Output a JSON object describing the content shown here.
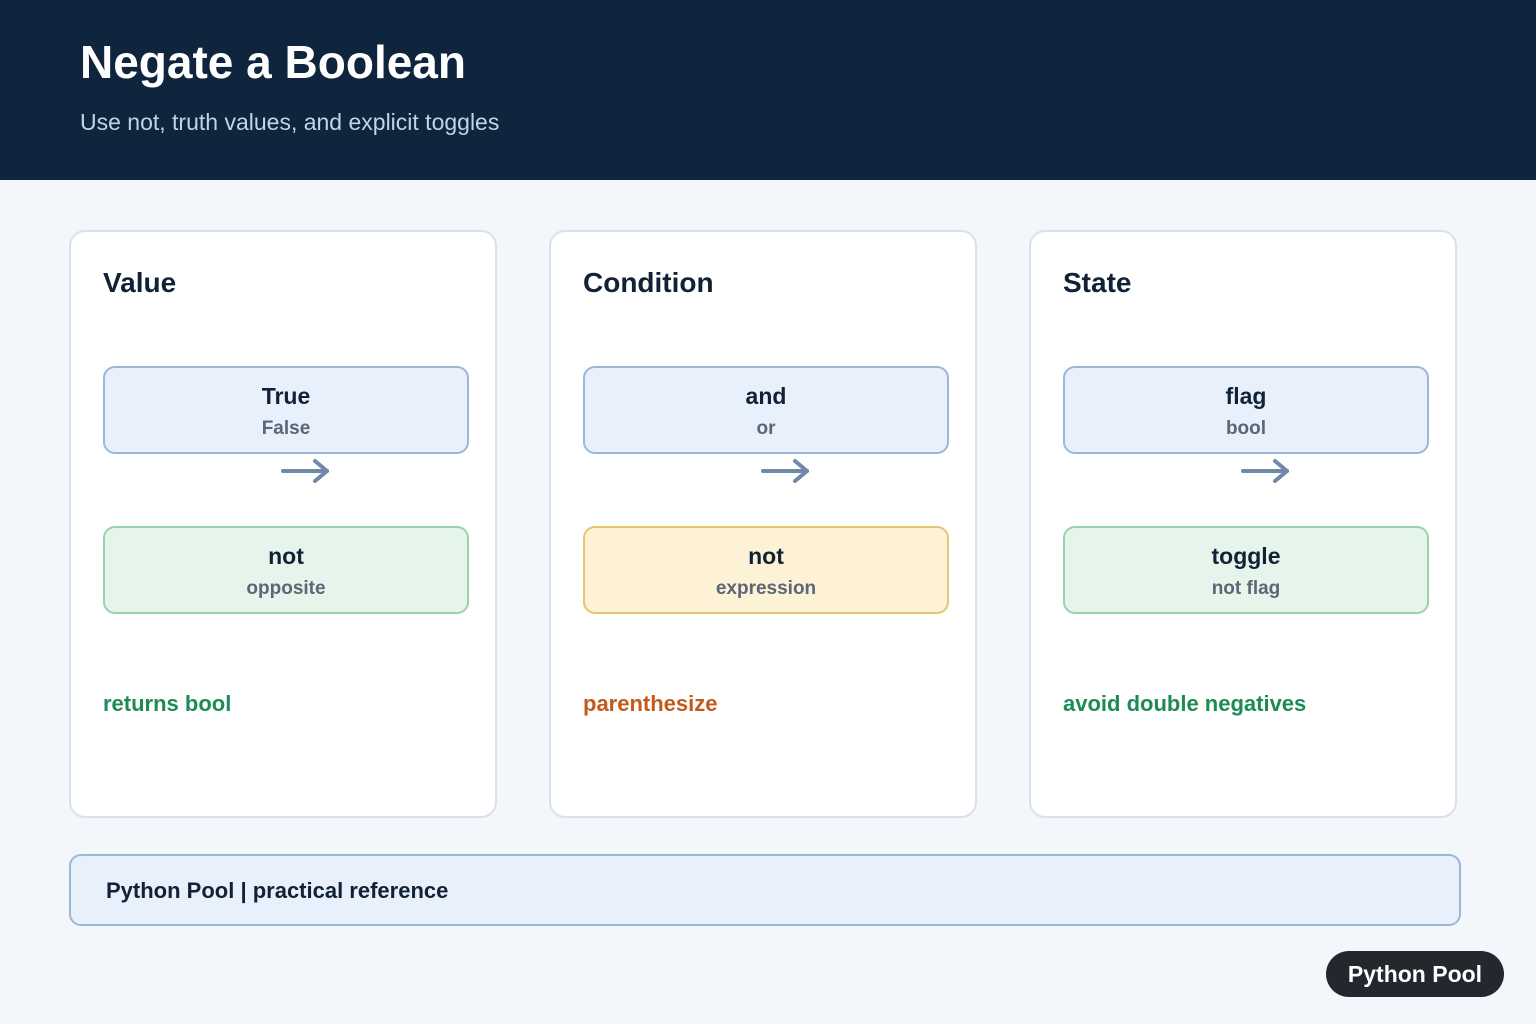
{
  "header": {
    "title": "Negate a Boolean",
    "subtitle": "Use not, truth values, and explicit toggles"
  },
  "colors": {
    "header_bg": "#0e253d",
    "note_green": "#1e8a55",
    "note_orange": "#c25a1c",
    "arrow": "#6e8aa8"
  },
  "cards": [
    {
      "title": "Value",
      "top": {
        "main": "True",
        "sub": "False"
      },
      "bottom": {
        "main": "not",
        "sub": "opposite"
      },
      "note": "returns bool"
    },
    {
      "title": "Condition",
      "top": {
        "main": "and",
        "sub": "or"
      },
      "bottom": {
        "main": "not",
        "sub": "expression"
      },
      "note": "parenthesize"
    },
    {
      "title": "State",
      "top": {
        "main": "flag",
        "sub": "bool"
      },
      "bottom": {
        "main": "toggle",
        "sub": "not flag"
      },
      "note": "avoid double negatives"
    }
  ],
  "footer": {
    "text": "Python Pool | practical reference"
  },
  "badge": {
    "label": "Python Pool"
  }
}
